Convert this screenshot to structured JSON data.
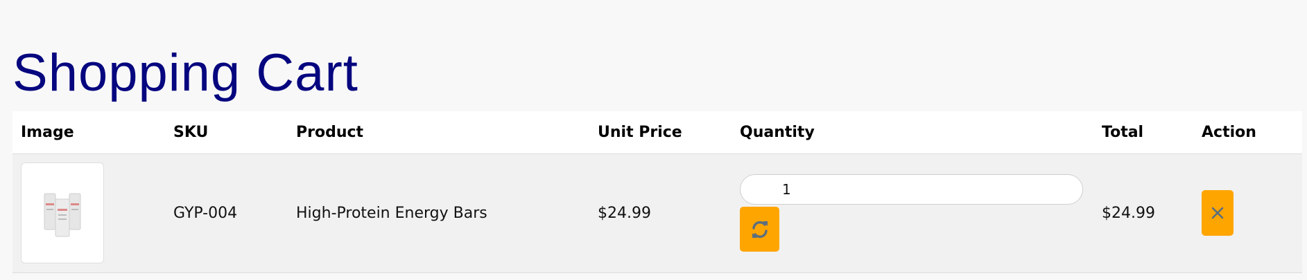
{
  "page": {
    "title": "Shopping Cart"
  },
  "table": {
    "headers": {
      "image": "Image",
      "sku": "SKU",
      "product": "Product",
      "unit_price": "Unit Price",
      "quantity": "Quantity",
      "total": "Total",
      "action": "Action"
    },
    "rows": [
      {
        "image_icon": "product-thumbnail",
        "sku": "GYP-004",
        "product": "High-Protein Energy Bars",
        "unit_price": "$24.99",
        "quantity": "1",
        "total": "$24.99",
        "update_icon": "refresh-icon",
        "remove_icon": "close-icon"
      }
    ]
  },
  "colors": {
    "title": "#06067f",
    "button": "#ffa500",
    "button_icon": "#5a6e80",
    "row_background": "#f1f1f1",
    "header_background": "#ffffff",
    "page_background": "#f8f8f9"
  }
}
